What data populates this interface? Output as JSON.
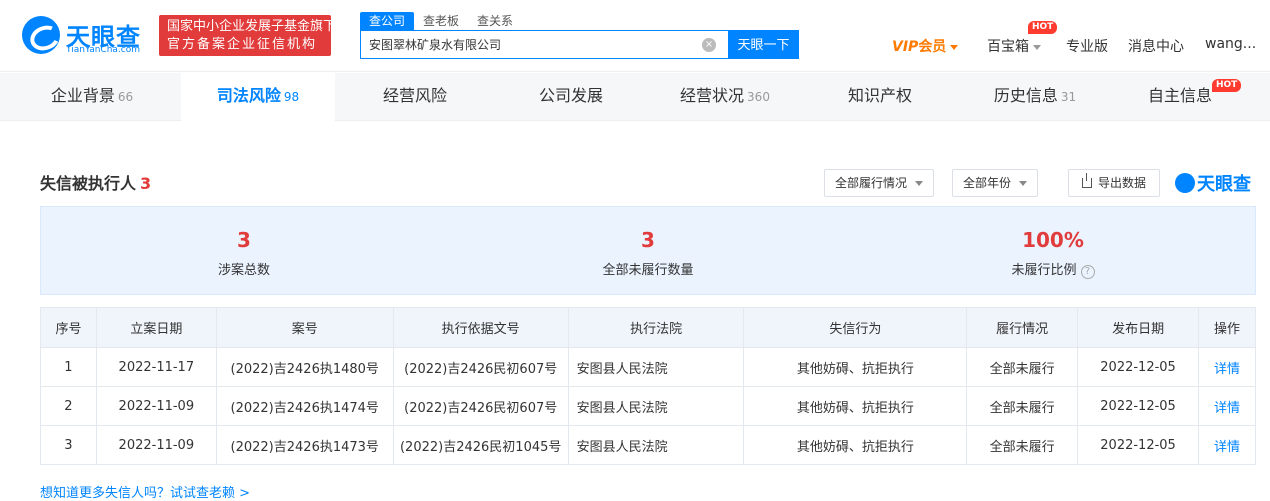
{
  "brand": {
    "name": "天眼查",
    "domain": "TianYanCha.com",
    "slogan_line1": "国家中小企业发展子基金旗下",
    "slogan_line2": "官方备案企业征信机构"
  },
  "search": {
    "tabs": [
      "查公司",
      "查老板",
      "查关系"
    ],
    "value": "安图翠林矿泉水有限公司",
    "button": "天眼一下"
  },
  "topnav": {
    "vip_mark": "VIP",
    "vip_text": "会员",
    "treasure": "百宝箱",
    "hot": "HOT",
    "pro": "专业版",
    "messages": "消息中心",
    "user": "wang..."
  },
  "tabs": [
    {
      "label": "企业背景",
      "count": "66"
    },
    {
      "label": "司法风险",
      "count": "98"
    },
    {
      "label": "经营风险",
      "count": ""
    },
    {
      "label": "公司发展",
      "count": ""
    },
    {
      "label": "经营状况",
      "count": "360"
    },
    {
      "label": "知识产权",
      "count": ""
    },
    {
      "label": "历史信息",
      "count": "31"
    },
    {
      "label": "自主信息",
      "count": ""
    }
  ],
  "tab_hot": "HOT",
  "section": {
    "title": "失信被执行人",
    "count": "3",
    "filter1": "全部履行情况",
    "filter2": "全部年份",
    "export": "导出数据",
    "brand": "天眼查"
  },
  "stats": [
    {
      "value": "3",
      "label": "涉案总数"
    },
    {
      "value": "3",
      "label": "全部未履行数量"
    },
    {
      "value": "100%",
      "label": "未履行比例"
    }
  ],
  "table": {
    "headers": [
      "序号",
      "立案日期",
      "案号",
      "执行依据文号",
      "执行法院",
      "失信行为",
      "履行情况",
      "发布日期",
      "操作"
    ],
    "rows": [
      [
        "1",
        "2022-11-17",
        "(2022)吉2426执1480号",
        "(2022)吉2426民初607号",
        "安图县人民法院",
        "其他妨碍、抗拒执行",
        "全部未履行",
        "2022-12-05",
        "详情"
      ],
      [
        "2",
        "2022-11-09",
        "(2022)吉2426执1474号",
        "(2022)吉2426民初607号",
        "安图县人民法院",
        "其他妨碍、抗拒执行",
        "全部未履行",
        "2022-12-05",
        "详情"
      ],
      [
        "3",
        "2022-11-09",
        "(2022)吉2426执1473号",
        "(2022)吉2426民初1045号",
        "安图县人民法院",
        "其他妨碍、抗拒执行",
        "全部未履行",
        "2022-12-05",
        "详情"
      ]
    ]
  },
  "bottom_tip": "想知道更多失信人吗？试试查老赖 >",
  "colors": {
    "accent": "#0084ff",
    "alert": "#e23b3b",
    "vip": "#ff7a00"
  }
}
